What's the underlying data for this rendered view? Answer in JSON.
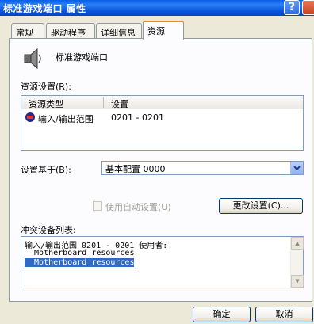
{
  "window": {
    "title": "标准游戏端口 属性",
    "help_label": "?"
  },
  "tabs": [
    {
      "label": "常规"
    },
    {
      "label": "驱动程序"
    },
    {
      "label": "详细信息"
    },
    {
      "label": "资源"
    }
  ],
  "device": {
    "name": "标准游戏端口",
    "icon": "speaker-icon"
  },
  "resource_settings": {
    "label": "资源设置(R):",
    "columns": [
      "资源类型",
      "设置"
    ],
    "rows": [
      {
        "type": "输入/输出范围",
        "setting": "0201 - 0201"
      }
    ]
  },
  "setting_based_on": {
    "label": "设置基于(B):",
    "value": "基本配置 0000"
  },
  "auto_setting": {
    "label": "使用自动设置(U)",
    "checked": false
  },
  "change_setting_button": "更改设置(C)...",
  "conflict": {
    "label": "冲突设备列表:",
    "lines": [
      "输入/输出范围 0201 - 0201 使用者:",
      "  Motherboard resources",
      "  Motherboard resources"
    ]
  },
  "buttons": {
    "ok": "确定",
    "cancel": "取消"
  }
}
